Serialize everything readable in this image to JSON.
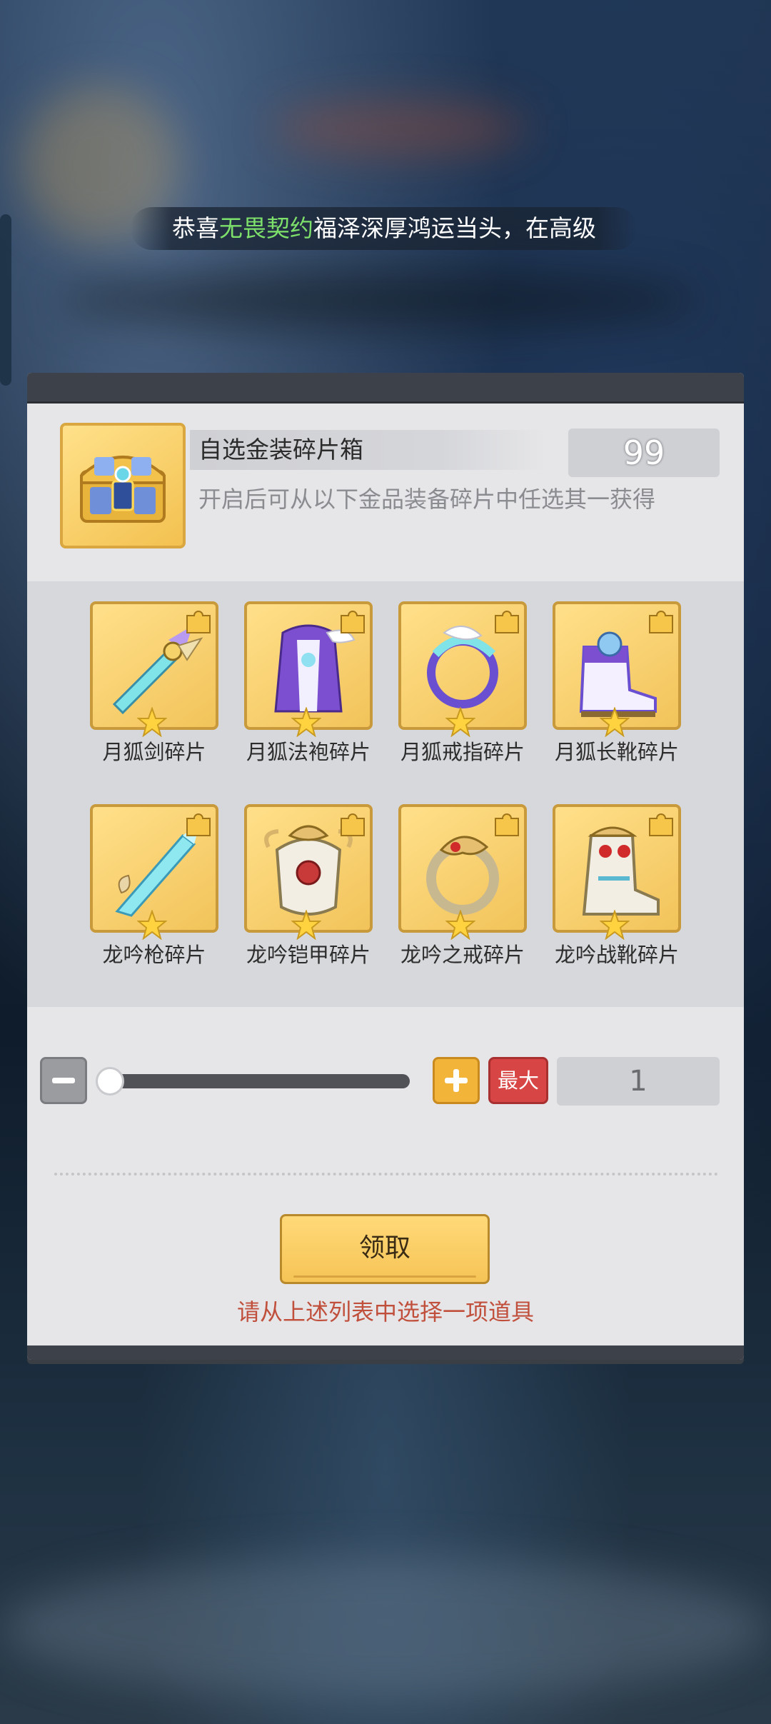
{
  "banner": {
    "prefix": "恭喜",
    "highlight": "无畏契约",
    "suffix": "福泽深厚鸿运当头，在高级"
  },
  "item": {
    "name": "自选金装碎片箱",
    "count": "99",
    "description": "开启后可从以下金品装备碎片中任选其一获得",
    "icon": "treasure-chest-icon"
  },
  "fragments": [
    {
      "label": "月狐剑碎片",
      "icon": "moon-fox-sword-icon"
    },
    {
      "label": "月狐法袍碎片",
      "icon": "moon-fox-robe-icon"
    },
    {
      "label": "月狐戒指碎片",
      "icon": "moon-fox-ring-icon"
    },
    {
      "label": "月狐长靴碎片",
      "icon": "moon-fox-boots-icon"
    },
    {
      "label": "龙吟枪碎片",
      "icon": "dragon-spear-icon"
    },
    {
      "label": "龙吟铠甲碎片",
      "icon": "dragon-armor-icon"
    },
    {
      "label": "龙吟之戒碎片",
      "icon": "dragon-ring-icon"
    },
    {
      "label": "龙吟战靴碎片",
      "icon": "dragon-boots-icon"
    }
  ],
  "quantity": {
    "max_label": "最大",
    "value": "1",
    "slider_fraction": 0.0
  },
  "claim": {
    "label": "领取",
    "hint": "请从上述列表中选择一项道具"
  },
  "colors": {
    "tile_gold": "#f2c35a",
    "highlight_green": "#7de06b",
    "hint_red": "#c0503c",
    "max_red": "#d84545",
    "plus_orange": "#f3b43a"
  }
}
